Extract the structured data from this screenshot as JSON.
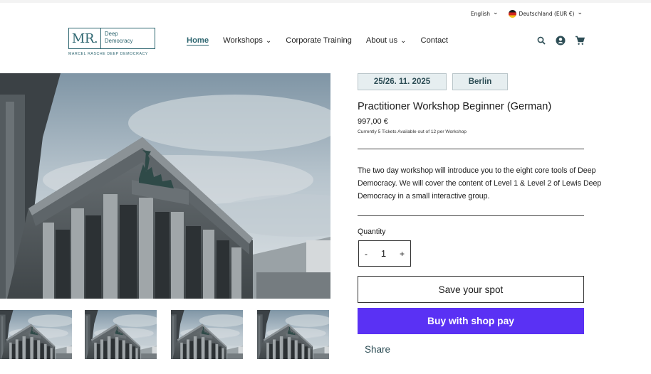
{
  "header": {
    "language": "English",
    "currency": "Deutschland (EUR €)",
    "logo": {
      "mark": "MR.",
      "line1": "Deep",
      "line2": "Democracy",
      "tagline": "MARCEL RASCHE DEEP DEMOCRACY"
    },
    "nav": [
      {
        "label": "Home",
        "active": true,
        "dropdown": false
      },
      {
        "label": "Workshops",
        "active": false,
        "dropdown": true
      },
      {
        "label": "Corporate Training",
        "active": false,
        "dropdown": false
      },
      {
        "label": "About us",
        "active": false,
        "dropdown": true
      },
      {
        "label": "Contact",
        "active": false,
        "dropdown": false
      }
    ],
    "icons": [
      "search-icon",
      "account-icon",
      "cart-icon"
    ]
  },
  "gallery": {
    "thumbnail_count": 4
  },
  "product": {
    "tags": [
      "25/26. 11. 2025",
      "Berlin"
    ],
    "title": "Practitioner Workshop Beginner (German)",
    "price": "997,00 €",
    "availability": "Currently 5 Tickets Available out of 12 per Workshop",
    "description": "The two day workshop will introduce you to the eight core tools of Deep Democracy. We will cover the content of Level 1 & Level 2 of Lewis Deep Democracy in a small interactive group.",
    "quantity_label": "Quantity",
    "quantity_minus": "-",
    "quantity_value": "1",
    "quantity_plus": "+",
    "save_label": "Save your spot",
    "shop_pay_label": "Buy with shop pay",
    "share_label": "Share"
  },
  "colors": {
    "accent": "#2e6670",
    "shop_pay": "#5a31f4",
    "tag_bg": "#e6eef0"
  }
}
